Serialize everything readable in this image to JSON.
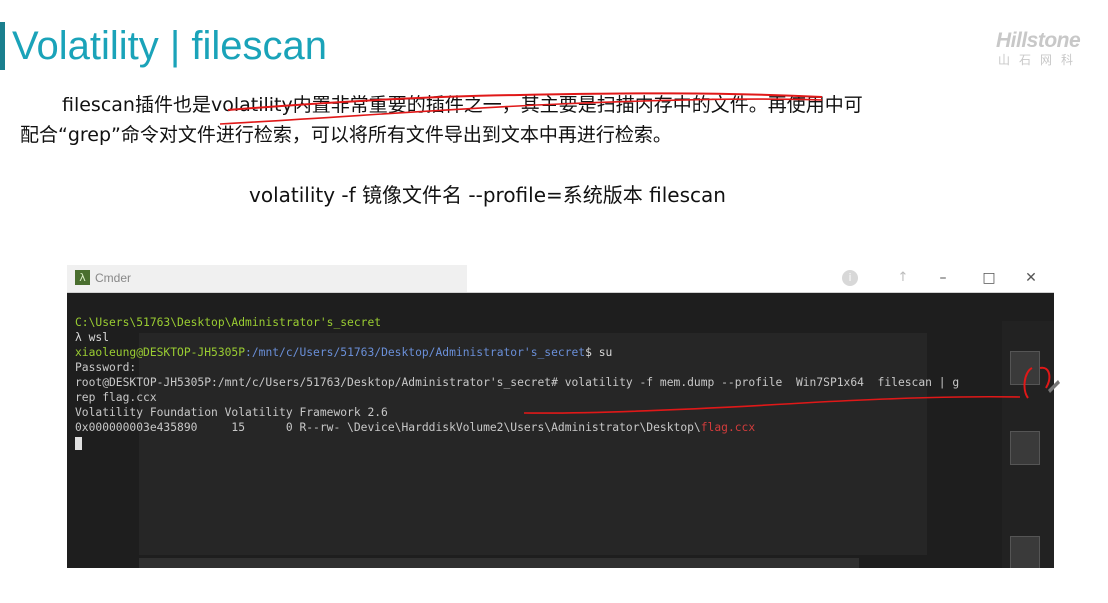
{
  "slide": {
    "title": "Volatility | filescan",
    "paragraph_line1": "filescan插件也是volatility内置非常重要的插件之一，其主要是扫描内存中的文件。再使用中可",
    "paragraph_line2": "配合“grep”命令对文件进行检索，可以将所有文件导出到文本中再进行检索。",
    "command": "volatility -f 镜像文件名 --profile=系统版本 filescan"
  },
  "logo": {
    "word": "Hillstone",
    "sub": "山石网科"
  },
  "window": {
    "app_title": "Cmder",
    "icon": "lambda-icon",
    "info_icon": "info-icon",
    "arrow_icon": "arrow-icon",
    "minimize": "–",
    "maximize": "□",
    "close": "✕"
  },
  "terminal": {
    "line1": "C:\\Users\\51763\\Desktop\\Administrator's_secret",
    "line2": "λ wsl",
    "line3_user": "xiaoleung@DESKTOP-JH5305P",
    "line3_path": ":/mnt/c/Users/51763/Desktop/Administrator's_secret",
    "line3_cmd": "$ su",
    "line4": "Password:",
    "line5": "root@DESKTOP-JH5305P:/mnt/c/Users/51763/Desktop/Administrator's_secret# volatility -f mem.dump --profile  Win7SP1x64  filescan | g",
    "line6": "rep flag.ccx",
    "line7": "Volatility Foundation Volatility Framework 2.6",
    "line8_prefix": "0x000000003e435890     15      0 R--rw- \\Device\\HarddiskVolume2\\Users\\Administrator\\Desktop\\",
    "line8_file": "flag.ccx"
  },
  "colors": {
    "title": "#1aa3b9",
    "accent_bar": "#1a7f8e",
    "annotation": "#e01818"
  }
}
